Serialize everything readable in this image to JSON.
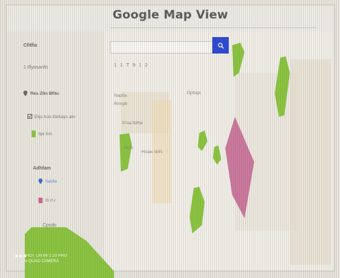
{
  "app": {
    "title": "Google Map View"
  },
  "sidebar": {
    "section1_title": "Cfitfia",
    "section1_value": "1 Iflyosanfo",
    "filter_label": "Rea Zlin Bfitu",
    "layer_toggle_label": "Elijs hoo iforkays ato",
    "legend_label": "tlpr hm",
    "section2_title": "Adhfam",
    "item_blue_label": "fiaidte",
    "item_pink_label": "tfi rf-r",
    "item_footer_label": "Cpsdo"
  },
  "map": {
    "search_value": "",
    "search_button_icon": "search-icon",
    "toolbar_items": [
      "1",
      "1",
      "T",
      "9",
      "1",
      "2"
    ],
    "labels": {
      "label_a": "Naptla",
      "label_b": "Gptsgx",
      "label_c": "Rrmpb",
      "label_d": "tPaa fbfha",
      "label_e": "Ahrb",
      "label_f": "Hnaw dofs"
    }
  },
  "watermark": {
    "line1": "SHOT ON MI 1 20 PRO",
    "line2": "AI QUAD CAMERA"
  },
  "colors": {
    "accent_blue": "#2c49d6",
    "region_green": "#8cc63f",
    "region_pink": "#c96b96"
  }
}
